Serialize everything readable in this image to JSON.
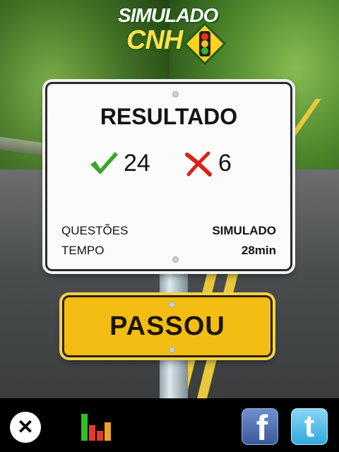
{
  "logo": {
    "line1": "SIMULADO",
    "line2": "CNH"
  },
  "result_sign": {
    "title": "RESULTADO",
    "correct_count": "24",
    "wrong_count": "6",
    "rows": [
      {
        "label": "QUESTÕES",
        "value": "SIMULADO"
      },
      {
        "label": "TEMPO",
        "value": "28min"
      }
    ]
  },
  "status_sign": {
    "label": "PASSOU"
  },
  "toolbar": {
    "close_icon": "close-icon",
    "stats_icon": "bar-chart-icon",
    "facebook_glyph": "f",
    "twitter_glyph": "t"
  },
  "colors": {
    "correct_check": "#3aa628",
    "wrong_cross": "#d8231a",
    "pass_sign": "#f4bd14",
    "facebook": "#3b5998",
    "twitter": "#2fa8dc"
  }
}
